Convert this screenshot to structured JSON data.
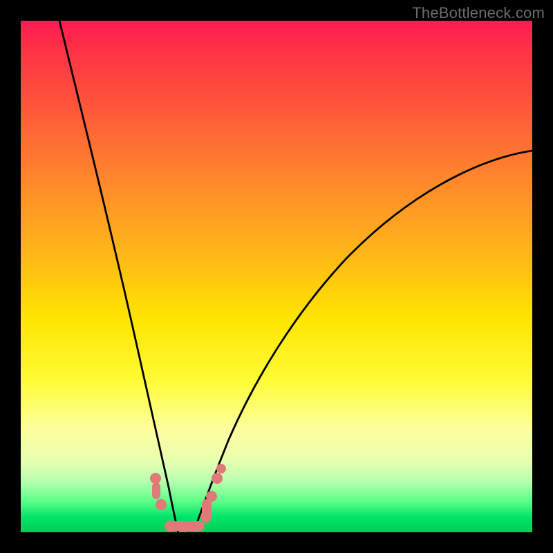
{
  "watermark": "TheBottleneck.com",
  "chart_data": {
    "type": "line",
    "title": "",
    "xlabel": "",
    "ylabel": "",
    "xlim": [
      0,
      100
    ],
    "ylim": [
      0,
      100
    ],
    "background": "rainbow-vertical",
    "series": [
      {
        "name": "left-curve",
        "x": [
          8,
          12,
          16,
          20,
          23,
          25,
          27,
          28.5,
          29.5,
          30
        ],
        "values": [
          100,
          78,
          55,
          35,
          20,
          12,
          7,
          3,
          1,
          0
        ]
      },
      {
        "name": "right-curve",
        "x": [
          30,
          34,
          40,
          48,
          58,
          70,
          84,
          100
        ],
        "values": [
          0,
          3,
          12,
          27,
          42,
          55,
          65,
          72
        ]
      }
    ],
    "markers": {
      "name": "salmon-marker-cluster",
      "color": "#de7a78",
      "points": [
        {
          "x": 26,
          "y": 9
        },
        {
          "x": 27,
          "y": 5
        },
        {
          "x": 29,
          "y": 1
        },
        {
          "x": 31,
          "y": 0.5
        },
        {
          "x": 33,
          "y": 1
        },
        {
          "x": 34.5,
          "y": 3
        },
        {
          "x": 37,
          "y": 8
        },
        {
          "x": 38,
          "y": 10
        }
      ]
    }
  }
}
